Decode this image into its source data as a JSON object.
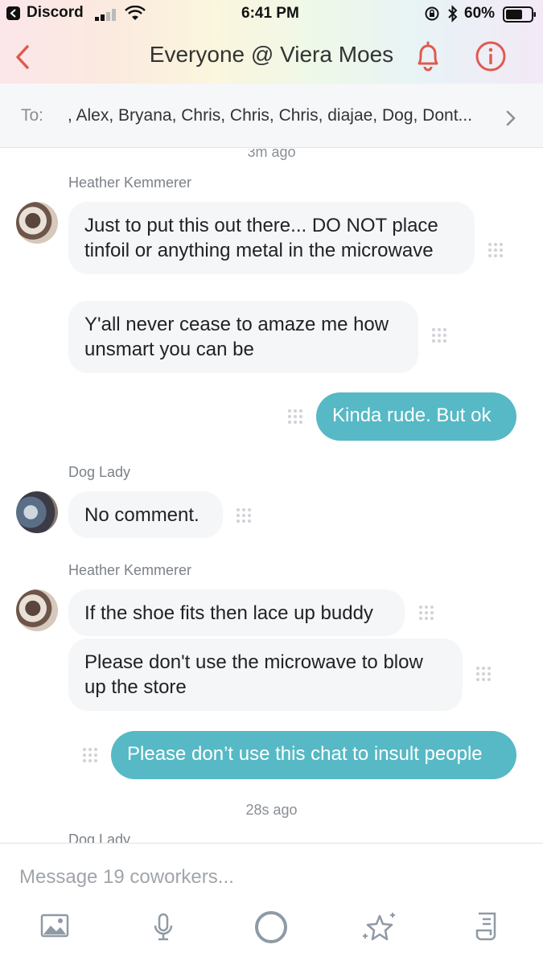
{
  "status_bar": {
    "app": "Discord",
    "time": "6:41 PM",
    "battery": "60%"
  },
  "header": {
    "title": "Everyone @ Viera Moes",
    "accent_color": "#e05a4f"
  },
  "recipients": {
    "label": "To:",
    "list": ", Alex, Bryana, Chris, Chris, Chris, diajae, Dog, Dont..."
  },
  "feed": {
    "timestamp_top": "3m ago",
    "groups": [
      {
        "sender": "Heather Kemmerer",
        "messages": [
          "Just to put this out there... DO NOT place tinfoil or anything metal in the microwave",
          "Y'all never cease to amaze me how unsmart you can be"
        ]
      },
      {
        "outgoing": "Kinda rude. But ok"
      },
      {
        "sender": "Dog Lady",
        "messages": [
          "No comment."
        ]
      },
      {
        "sender": "Heather Kemmerer",
        "messages": [
          "If the shoe fits then lace up buddy",
          "Please don't use the microwave to blow up the store"
        ]
      },
      {
        "outgoing": "Please don’t use this chat to insult people"
      }
    ],
    "timestamp_bottom": "28s ago",
    "next_sender": "Dog Lady",
    "outgoing_color": "#56b9c5"
  },
  "composer": {
    "placeholder": "Message 19 coworkers...",
    "tools": [
      "image-icon",
      "microphone-icon",
      "circle-icon",
      "sparkle-star-icon",
      "document-icon"
    ]
  }
}
